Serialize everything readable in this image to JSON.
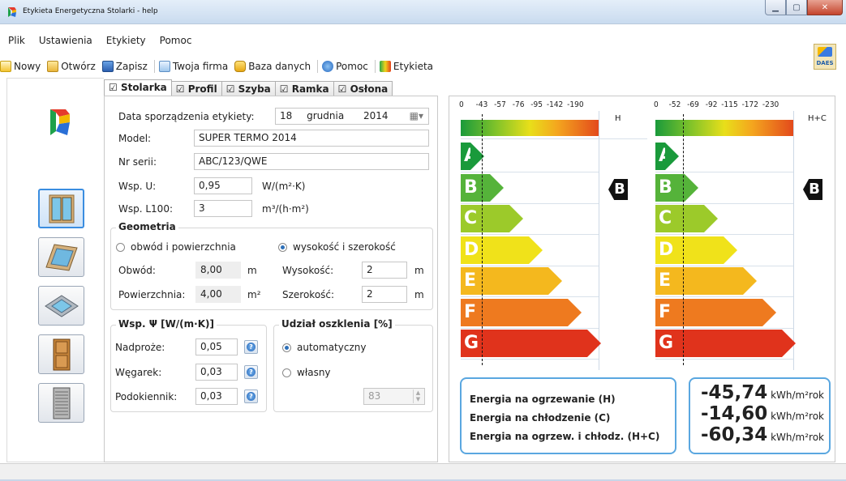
{
  "window": {
    "title": "Etykieta Energetyczna Stolarki - help"
  },
  "menu": [
    "Plik",
    "Ustawienia",
    "Etykiety",
    "Pomoc"
  ],
  "toolbar": [
    {
      "label": "Nowy",
      "icon": "new-file-icon"
    },
    {
      "label": "Otwórz",
      "icon": "open-folder-icon"
    },
    {
      "label": "Zapisz",
      "icon": "save-disk-icon"
    },
    {
      "label": "Twoja firma",
      "icon": "company-card-icon"
    },
    {
      "label": "Baza danych",
      "icon": "database-icon"
    },
    {
      "label": "Pomoc",
      "icon": "help-icon"
    },
    {
      "label": "Etykieta",
      "icon": "label-icon"
    }
  ],
  "brand": {
    "logo_text": "DAES"
  },
  "tabs": [
    "Stolarka",
    "Profil",
    "Szyba",
    "Ramka",
    "Osłona"
  ],
  "form": {
    "date_label": "Data sporządzenia etykiety:",
    "date_day": "18",
    "date_month": "grudnia",
    "date_year": "2014",
    "model_label": "Model:",
    "model_value": "SUPER TERMO 2014",
    "serial_label": "Nr serii:",
    "serial_value": "ABC/123/QWE",
    "u_label": "Wsp. U:",
    "u_value": "0,95",
    "u_unit": "W/(m²·K)",
    "l100_label": "Wsp. L100:",
    "l100_value": "3",
    "l100_unit": "m³/(h·m²)"
  },
  "geometry": {
    "title": "Geometria",
    "opt1": "obwód i powierzchnia",
    "opt2": "wysokość i szerokość",
    "perimeter_label": "Obwód:",
    "perimeter_value": "8,00",
    "perimeter_unit": "m",
    "area_label": "Powierzchnia:",
    "area_value": "4,00",
    "area_unit": "m²",
    "height_label": "Wysokość:",
    "height_value": "2",
    "height_unit": "m",
    "width_label": "Szerokość:",
    "width_value": "2",
    "width_unit": "m"
  },
  "psi": {
    "title": "Wsp. Ψ [W/(m·K)]",
    "lintel_label": "Nadproże:",
    "lintel_value": "0,05",
    "corner_label": "Węgarek:",
    "corner_value": "0,03",
    "sill_label": "Podokiennik:",
    "sill_value": "0,03"
  },
  "glazing": {
    "title": "Udział oszklenia [%]",
    "auto_label": "automatyczny",
    "own_label": "własny",
    "value": "83"
  },
  "label_h": {
    "scale": [
      "0",
      "-43",
      "-57",
      "-76",
      "-95",
      "-142",
      "-190"
    ],
    "header": "H",
    "rating": "B"
  },
  "label_hc": {
    "scale": [
      "0",
      "-52",
      "-69",
      "-92",
      "-115",
      "-172",
      "-230"
    ],
    "header": "H+C",
    "rating": "B"
  },
  "classes": [
    "A",
    "B",
    "C",
    "D",
    "E",
    "F",
    "G"
  ],
  "class_colors": [
    "#1a9a3b",
    "#55b33a",
    "#9cca2a",
    "#f0e21a",
    "#f4b81e",
    "#ee7a1f",
    "#e0331c"
  ],
  "energy": {
    "heating_label": "Energia na ogrzewanie (H)",
    "cooling_label": "Energia na chłodzenie (C)",
    "total_label": "Energia na ogrzew. i chłodz. (H+C)",
    "heating_value": "-45,74",
    "cooling_value": "-14,60",
    "total_value": "-60,34",
    "unit": "kWh/m²rok"
  }
}
